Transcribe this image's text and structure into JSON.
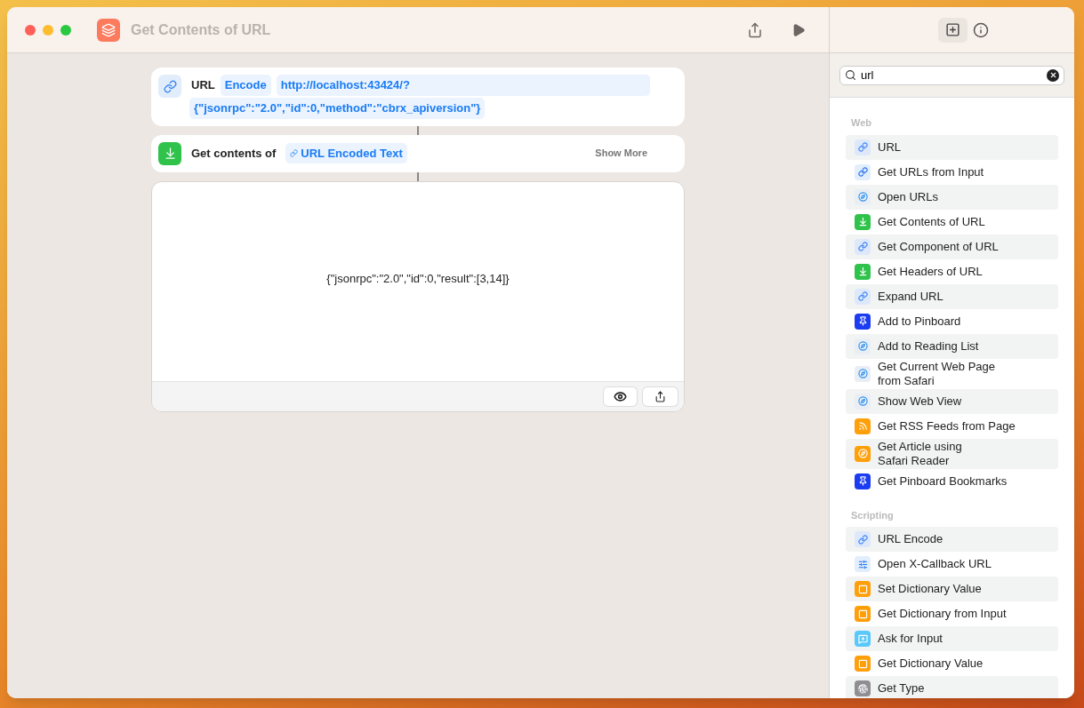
{
  "window": {
    "title": "Get Contents of URL"
  },
  "url_action": {
    "label": "URL",
    "option": "Encode",
    "value_lines": [
      "http://localhost:43424/?",
      "{\"jsonrpc\":\"2.0\",\"id\":0,\"method\":\"cbrx_apiversion\"}"
    ]
  },
  "get_contents_action": {
    "label": "Get contents of",
    "variable": "URL Encoded Text",
    "more": "Show More"
  },
  "result": {
    "text": "{\"jsonrpc\":\"2.0\",\"id\":0,\"result\":[3,14]}"
  },
  "search": {
    "value": "url"
  },
  "sections": [
    {
      "title": "Web",
      "items": [
        {
          "label": "URL",
          "kind": "link"
        },
        {
          "label": "Get URLs from Input",
          "kind": "urls"
        },
        {
          "label": "Open URLs",
          "kind": "safari"
        },
        {
          "label": "Get Contents of URL",
          "kind": "download"
        },
        {
          "label": "Get Component of URL",
          "kind": "link"
        },
        {
          "label": "Get Headers of URL",
          "kind": "download"
        },
        {
          "label": "Expand URL",
          "kind": "link"
        },
        {
          "label": "Add to Pinboard",
          "kind": "pin"
        },
        {
          "label": "Add to Reading List",
          "kind": "safari"
        },
        {
          "label": "Get Current Web Page\nfrom Safari",
          "kind": "safari"
        },
        {
          "label": "Show Web View",
          "kind": "safari"
        },
        {
          "label": "Get RSS Feeds from Page",
          "kind": "rss"
        },
        {
          "label": "Get Article using\nSafari Reader",
          "kind": "reader"
        },
        {
          "label": "Get Pinboard Bookmarks",
          "kind": "pin"
        }
      ]
    },
    {
      "title": "Scripting",
      "items": [
        {
          "label": "URL Encode",
          "kind": "link"
        },
        {
          "label": "Open X-Callback URL",
          "kind": "callback"
        },
        {
          "label": "Set Dictionary Value",
          "kind": "dict"
        },
        {
          "label": "Get Dictionary from Input",
          "kind": "dict"
        },
        {
          "label": "Ask for Input",
          "kind": "ask"
        },
        {
          "label": "Get Dictionary Value",
          "kind": "dict"
        },
        {
          "label": "Get Type",
          "kind": "type"
        }
      ]
    }
  ]
}
